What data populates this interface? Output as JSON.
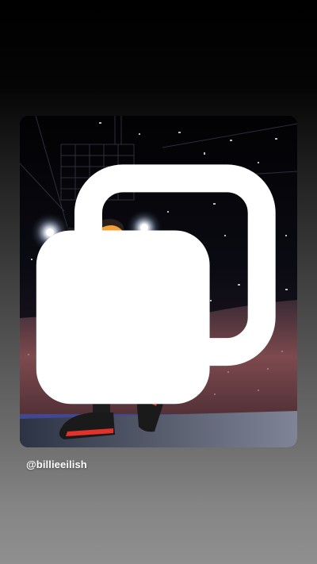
{
  "story": {
    "mention": "@billieeilish",
    "post_preview": {
      "media_type_icon": "multiple-photos-icon",
      "photo_description_icon": "concert-photo"
    }
  },
  "colors": {
    "background_top": "#000000",
    "background_bottom": "#8f8f8f",
    "mention_text": "#ffffff"
  }
}
